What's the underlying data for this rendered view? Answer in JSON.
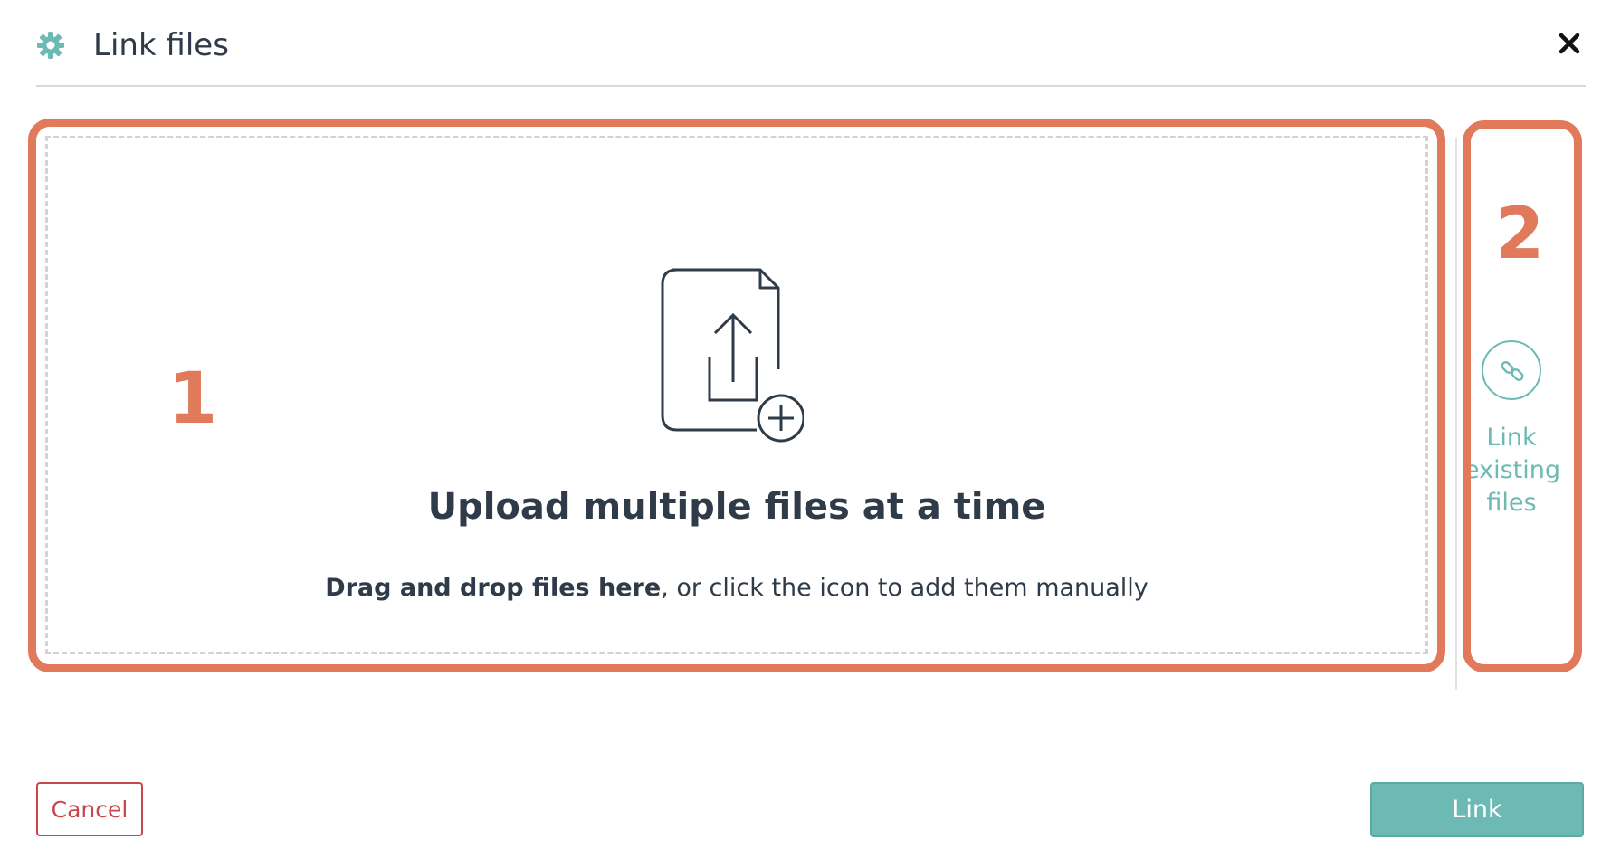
{
  "dialog": {
    "title": "Link files",
    "header_icon": "gear-icon",
    "close_icon": "close-icon"
  },
  "annotations": {
    "label_1": "1",
    "label_2": "2",
    "color": "#e07a5a"
  },
  "dropzone": {
    "icon": "file-upload-icon",
    "title": "Upload multiple files at a time",
    "subtitle_bold": "Drag and drop files here",
    "subtitle_rest": ", or click the icon to add them manually"
  },
  "link_existing": {
    "icon": "link-icon",
    "label_line1": "Link",
    "label_line2": "existing",
    "label_line3": "files"
  },
  "footer": {
    "cancel_label": "Cancel",
    "link_label": "Link"
  },
  "colors": {
    "accent": "#6dbab4",
    "danger": "#c8474d",
    "text": "#2f3b48"
  }
}
